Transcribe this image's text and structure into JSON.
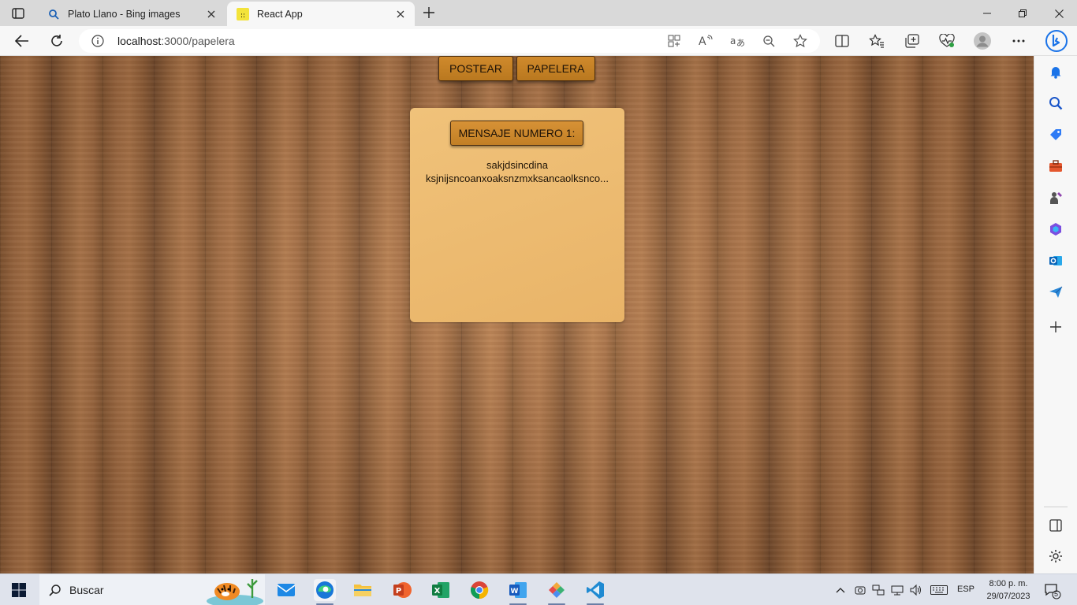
{
  "tabs": [
    {
      "title": "Plato Llano - Bing images",
      "icon": "search-icon"
    },
    {
      "title": "React App",
      "icon": "react-app-icon"
    }
  ],
  "address_bar": {
    "host": "localhost",
    "path": ":3000/papelera"
  },
  "page": {
    "nav_buttons": [
      "POSTEAR",
      "PAPELERA"
    ],
    "card": {
      "title": "MENSAJE NUMERO 1:",
      "line1": "sakjdsincdina",
      "line2": "ksjnijsncoanxoaksnzmxksancaolksnco..."
    }
  },
  "taskbar": {
    "search_label": "Buscar",
    "language": "ESP",
    "time": "8:00 p. m.",
    "date": "29/07/2023",
    "notification_count": "5"
  },
  "colors": {
    "button_fill": "#c98424",
    "card_fill": "#ecbb70",
    "wood_dark": "#7c5030",
    "wood_light": "#b47a4c"
  }
}
